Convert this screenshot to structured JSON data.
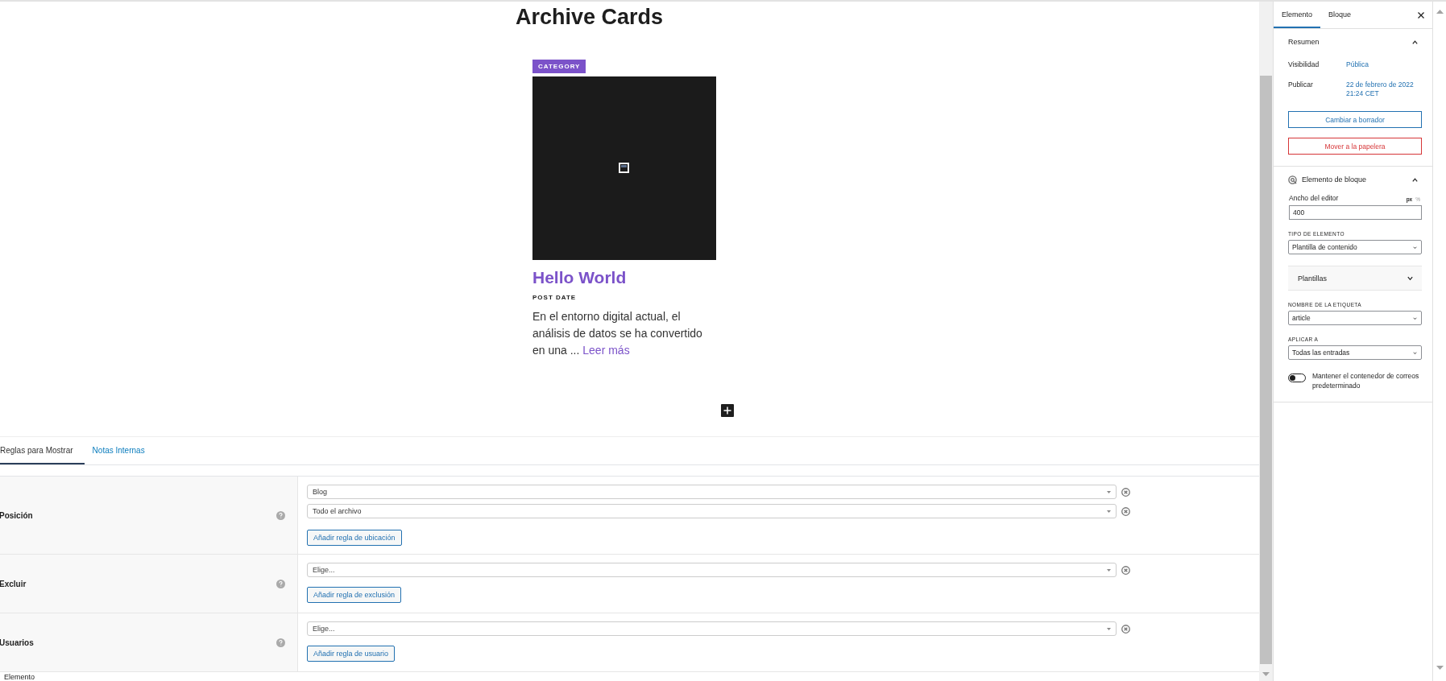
{
  "page_title": "Archive Cards",
  "card": {
    "category": "CATEGORY",
    "title": "Hello World",
    "date": "POST DATE",
    "excerpt": "En el entorno digital actual, el análisis de datos se ha convertido en una ...",
    "read_more": "Leer más"
  },
  "rules_tabs": [
    {
      "label": "Reglas para Mostrar",
      "selected": true
    },
    {
      "label": "Notas Internas",
      "selected": false
    }
  ],
  "rules": [
    {
      "label": "Posición",
      "fields": [
        {
          "value": "Blog"
        },
        {
          "value": "Todo el archivo"
        }
      ],
      "button": "Añadir regla de ubicación"
    },
    {
      "label": "Excluir",
      "fields": [
        {
          "placeholder": "Elige..."
        }
      ],
      "button": "Añadir regla de exclusión"
    },
    {
      "label": "Usuarios",
      "fields": [
        {
          "placeholder": "Elige..."
        }
      ],
      "button": "Añadir regla de usuario"
    }
  ],
  "status_bar": "Elemento",
  "sidebar": {
    "tabs": [
      {
        "label": "Elemento",
        "selected": true
      },
      {
        "label": "Bloque",
        "selected": false
      }
    ],
    "summary": {
      "title": "Resumen",
      "expanded": true,
      "rows": [
        {
          "label": "Visibilidad",
          "value": "Pública"
        },
        {
          "label": "Publicar",
          "value": "22 de febrero de 2022 21:24 CET"
        }
      ],
      "buttons": [
        {
          "label": "Cambiar a borrador",
          "kind": "primary"
        },
        {
          "label": "Mover a la papelera",
          "kind": "danger"
        }
      ]
    },
    "block": {
      "title": "Elemento de bloque",
      "expanded": true,
      "editor_width": {
        "label": "Ancho del editor",
        "value": "400",
        "units": [
          {
            "label": "px",
            "selected": true
          },
          {
            "label": "%",
            "selected": false
          }
        ]
      },
      "element_type": {
        "label": "TIPO DE ELEMENTO",
        "value": "Plantilla de contenido"
      },
      "templates": {
        "title": "Plantillas",
        "expanded": false
      },
      "tag_name": {
        "label": "NOMBRE DE LA ETIQUETA",
        "value": "article"
      },
      "apply_to": {
        "label": "APLICAR A",
        "value": "Todas las entradas"
      },
      "toggle": {
        "label": "Mantener el contenedor de correos predeterminado",
        "on": false
      }
    }
  }
}
